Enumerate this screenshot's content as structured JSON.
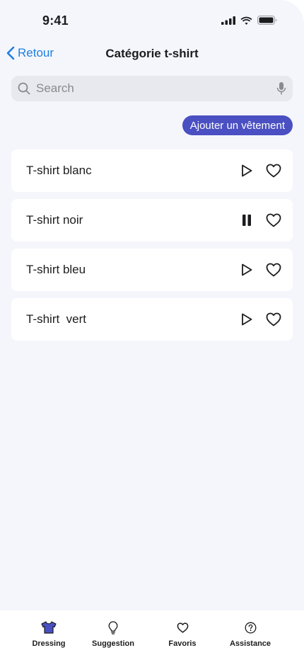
{
  "status_bar": {
    "time": "9:41"
  },
  "nav": {
    "back_label": "Retour",
    "title": "Catégorie t-shirt"
  },
  "search": {
    "placeholder": "Search",
    "value": ""
  },
  "add_button_label": "Ajouter un vêtement",
  "items": [
    {
      "label": "T-shirt blanc",
      "state": "play"
    },
    {
      "label": "T-shirt noir",
      "state": "pause"
    },
    {
      "label": "T-shirt bleu",
      "state": "play"
    },
    {
      "label": "T-shirt  vert",
      "state": "play"
    }
  ],
  "tabs": [
    {
      "label": "Dressing",
      "icon": "tshirt-icon",
      "active": true
    },
    {
      "label": "Suggestion",
      "icon": "lightbulb-icon",
      "active": false
    },
    {
      "label": "Favoris",
      "icon": "heart-icon",
      "active": false
    },
    {
      "label": "Assistance",
      "icon": "question-circle-icon",
      "active": false
    }
  ],
  "colors": {
    "accent": "#4a4fc2",
    "link": "#1f7fe0",
    "background": "#f5f6fc"
  }
}
